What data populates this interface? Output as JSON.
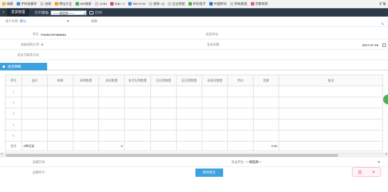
{
  "bookmarks": {
    "items": [
      {
        "label": "收藏",
        "color": "#f2b233"
      },
      {
        "label": "手机收藏夹",
        "color": "#3d8fe0"
      },
      {
        "label": "谷歌",
        "color": "#cccccc"
      },
      {
        "label": "网址大全",
        "color": "#f0a020"
      },
      {
        "label": "360搜索",
        "color": "#38b249"
      },
      {
        "label": "Links",
        "color": "#cccccc"
      },
      {
        "label": "http---c",
        "color": "#d94b4b"
      },
      {
        "label": "Win-8-W",
        "color": "#3e8ede"
      },
      {
        "label": "搜索--Q",
        "color": "#cccccc"
      },
      {
        "label": "企业智能",
        "color": "#cccccc"
      },
      {
        "label": "折扣电子",
        "color": "#55aa44"
      },
      {
        "label": "中国移动",
        "color": "#2277cc"
      },
      {
        "label": "新闻报道",
        "color": "#cccccc"
      },
      {
        "label": "京都采购",
        "color": "#e05a86"
      }
    ],
    "right_label": "扩展"
  },
  "header": {
    "back_glyph": "‹",
    "title": "发货管理",
    "print_template_label": "打印模板:",
    "print_template_value": "——请选择——",
    "print_template_arrow": "»",
    "print_button": "打印"
  },
  "form": {
    "customer_label": "客户名称:",
    "customer_value": "默认",
    "customer_arrow": "»",
    "remark_label": "摘要:",
    "doc_no_label": "单号:",
    "doc_no_value": "FH201787360001",
    "shipper_label": "发货单位:",
    "related_purchase_label": "关联采购订单:",
    "related_purchase_arrow": "»",
    "ship_date_label": "发货日期:",
    "ship_date_value": "2017-07-26",
    "payment_label": "发货方联系方式:"
  },
  "section": {
    "title": "发货明细"
  },
  "table": {
    "headers": [
      "序号",
      "品名",
      "规格",
      "采购数量",
      "发货数量",
      "本次在销数量",
      "已在销数量",
      "应在销数量",
      "未发货数量",
      "单价",
      "金额",
      "备注"
    ],
    "row_numbers": [
      "1",
      "2",
      "3",
      "4",
      "5"
    ],
    "total_label": "合计",
    "total_item_text": "0种记录",
    "total_ship_qty": "0",
    "total_amount": "0.00"
  },
  "scrollbar": {
    "left_glyph": "<",
    "right_glyph": ">"
  },
  "footer": {
    "delivery_method_label": "运输方式:",
    "receive_unit_label": "承运单位:",
    "receive_unit_value": "—请选择—",
    "receive_unit_arrow": "»",
    "waybill_label": "运输单号:",
    "save_button": "保存提交"
  },
  "ime": {
    "text": "英"
  },
  "colors": {
    "header_bg": "#2d3a4a",
    "accent": "#3ea2e0",
    "side_tab": "#49b35a"
  }
}
